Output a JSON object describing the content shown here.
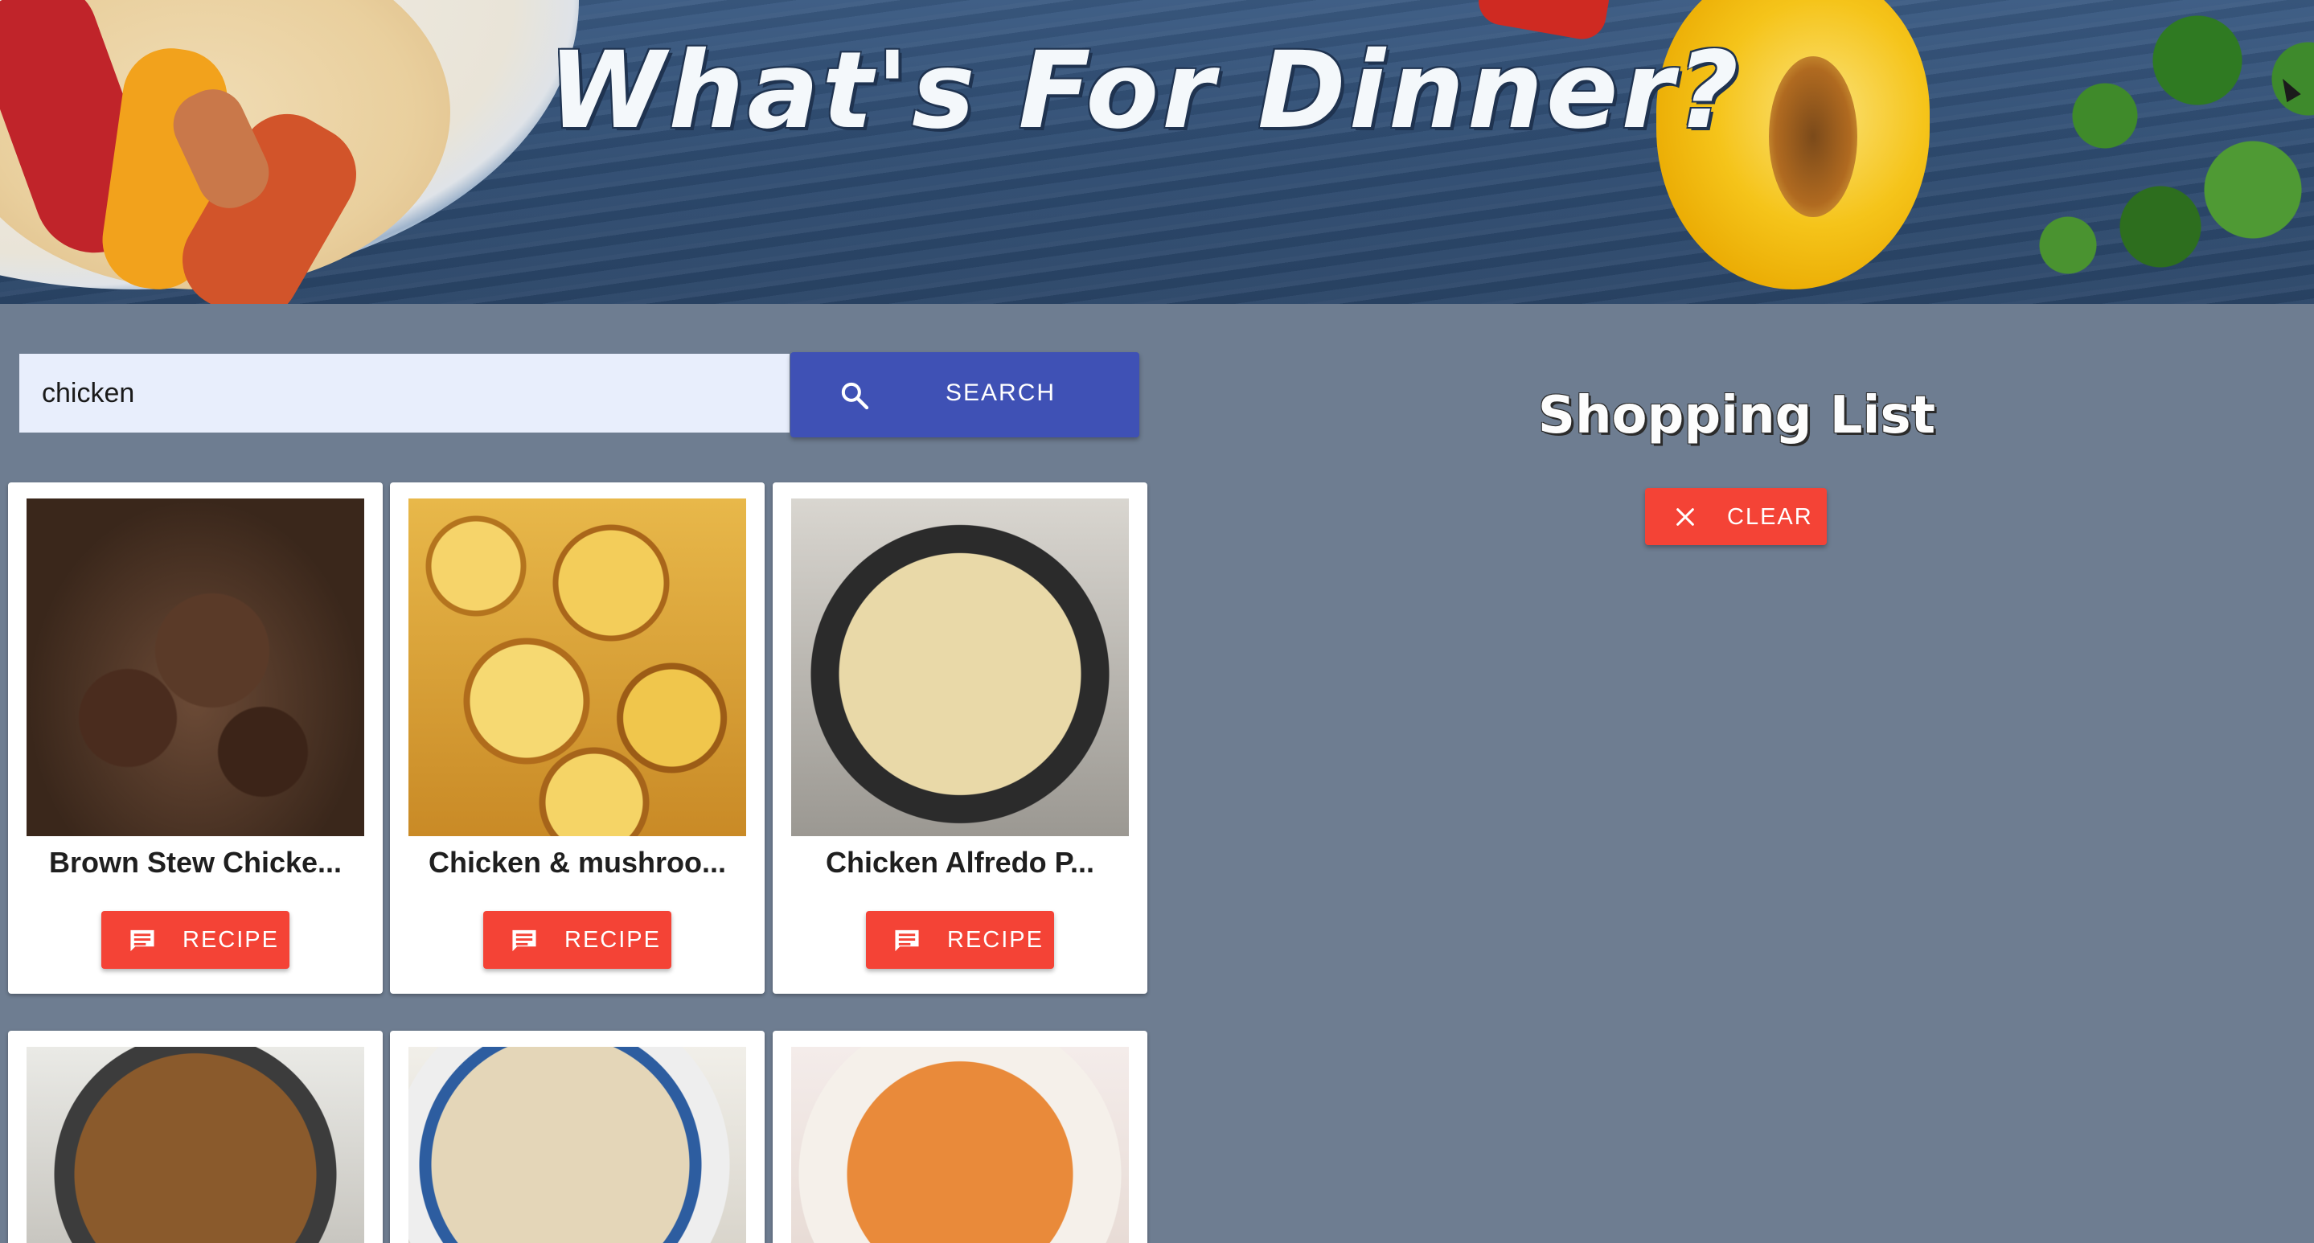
{
  "header": {
    "title": "What's For Dinner?"
  },
  "search": {
    "value": "chicken",
    "button_label": "SEARCH",
    "button_icon": "search-icon"
  },
  "results": [
    {
      "title": "Brown Stew Chicke...",
      "button_label": "RECIPE",
      "button_icon": "chat-bubble-icon"
    },
    {
      "title": "Chicken & mushroo...",
      "button_label": "RECIPE",
      "button_icon": "chat-bubble-icon"
    },
    {
      "title": "Chicken Alfredo P...",
      "button_label": "RECIPE",
      "button_icon": "chat-bubble-icon"
    },
    {
      "title": "",
      "button_label": "",
      "button_icon": ""
    },
    {
      "title": "",
      "button_label": "",
      "button_icon": ""
    },
    {
      "title": "",
      "button_label": "",
      "button_icon": ""
    }
  ],
  "shopping_list": {
    "title": "Shopping List",
    "clear_label": "CLEAR",
    "clear_icon": "close-icon"
  },
  "colors": {
    "page_background": "#6e7d91",
    "search_button": "#3f51b5",
    "action_button": "#f44336",
    "search_field": "#e8eefc"
  }
}
